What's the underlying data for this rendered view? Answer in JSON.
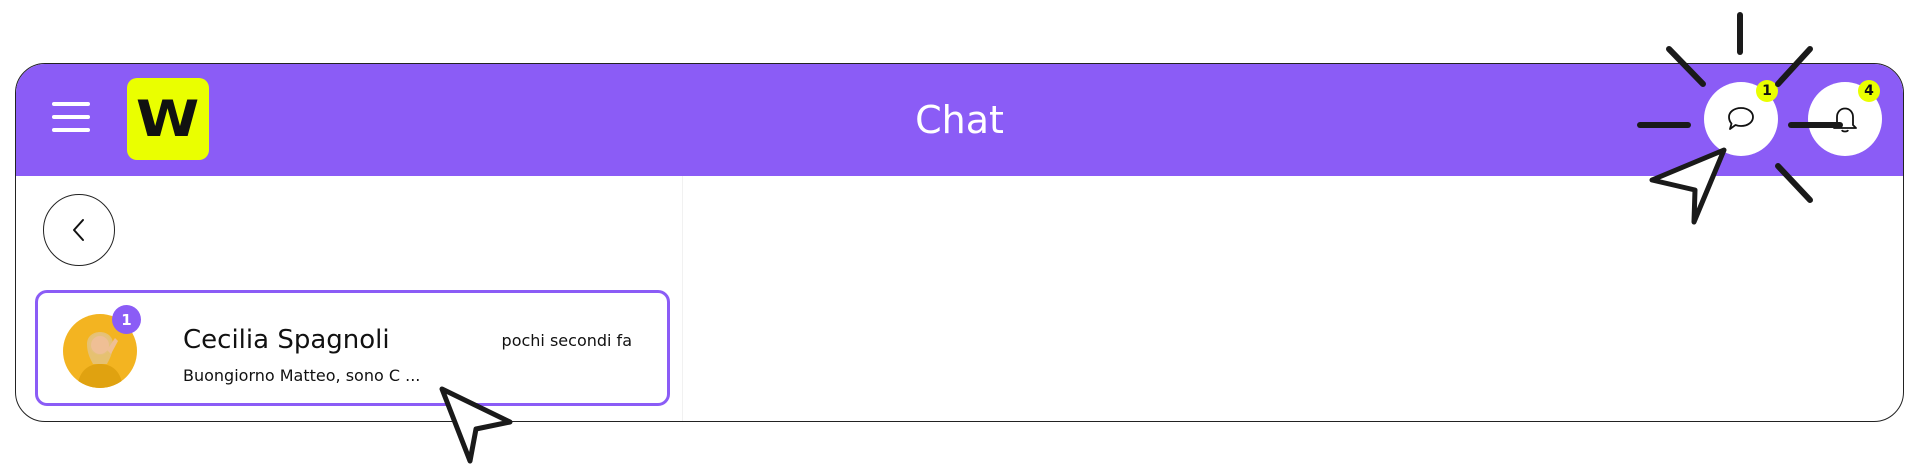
{
  "header": {
    "title": "Chat",
    "logo_letter": "W",
    "brand_color": "#8b5cf6",
    "logo_color": "#eaff00",
    "menu_icon": "hamburger-menu-icon",
    "chat_icon": "chat-bubble-icon",
    "chat_badge": "1",
    "bell_icon": "bell-icon",
    "bell_badge": "4"
  },
  "sidebar": {
    "back_icon": "chevron-left-icon",
    "conversations": [
      {
        "name": "Cecilia Spagnoli",
        "preview": "Buongiorno Matteo, sono C ...",
        "time": "pochi secondi fa",
        "unread": "1"
      }
    ]
  }
}
